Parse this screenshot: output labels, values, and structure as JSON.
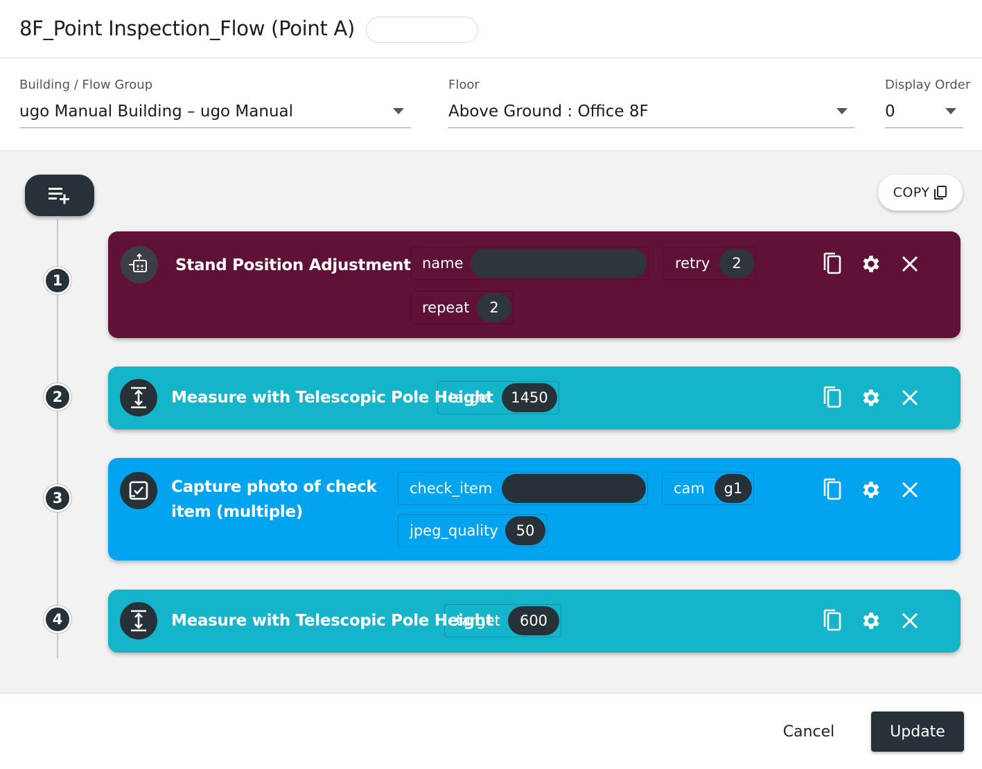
{
  "header": {
    "title": "8F_Point Inspection_Flow (Point A)"
  },
  "selectors": {
    "building": {
      "label": "Building / Flow Group",
      "value": "ugo Manual Building – ugo Manual"
    },
    "floor": {
      "label": "Floor",
      "value": "Above Ground : Office 8F"
    },
    "display_order": {
      "label": "Display Order",
      "value": "0"
    }
  },
  "toolbar": {
    "copy_label": "COPY"
  },
  "steps": [
    {
      "number": "1",
      "title": "Stand Position Adjustment",
      "color": "#5f1235",
      "params": [
        {
          "label": "name",
          "value": ""
        },
        {
          "label": "retry",
          "value": "2"
        },
        {
          "label": "repeat",
          "value": "2"
        }
      ]
    },
    {
      "number": "2",
      "title": "Measure with Telescopic Pole Height",
      "color": "#14b4cb",
      "params": [
        {
          "label": "target",
          "value": "1450"
        }
      ]
    },
    {
      "number": "3",
      "title_line1": "Capture photo of check",
      "title_line2": "item (multiple)",
      "color": "#03a4ef",
      "params": [
        {
          "label": "check_item",
          "value": ""
        },
        {
          "label": "cam",
          "value": "g1"
        },
        {
          "label": "jpeg_quality",
          "value": "50"
        }
      ]
    },
    {
      "number": "4",
      "title": "Measure with Telescopic Pole Height",
      "color": "#14b4cb",
      "params": [
        {
          "label": "target",
          "value": "600"
        }
      ]
    }
  ],
  "footer": {
    "cancel_label": "Cancel",
    "update_label": "Update"
  }
}
